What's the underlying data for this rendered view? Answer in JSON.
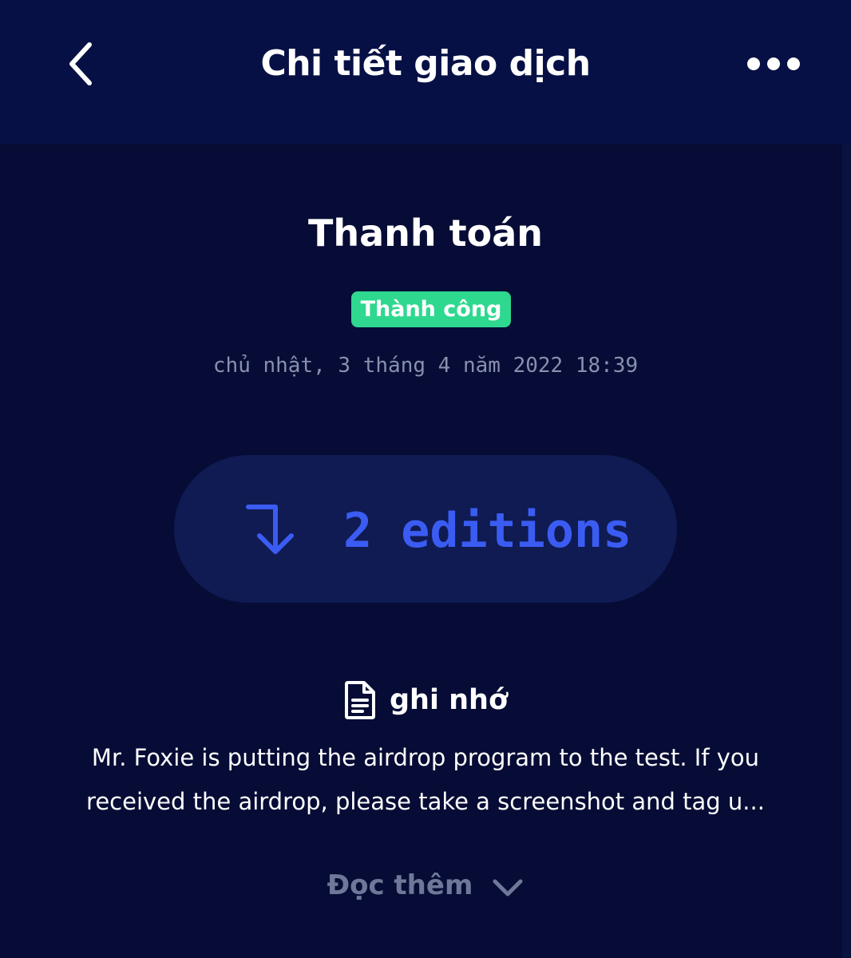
{
  "header": {
    "title": "Chi tiết giao dịch",
    "back_icon": "chevron-left-icon",
    "more_icon": "more-horizontal-icon"
  },
  "transaction": {
    "type": "Thanh toán",
    "status": "Thành công",
    "status_color": "#2fd88f",
    "date": "chủ nhật, 3 tháng 4 năm 2022 18:39",
    "amount": "2 editions",
    "amount_icon": "arrow-turn-down-icon",
    "accent_color": "#3b5cf3"
  },
  "note": {
    "icon": "document-icon",
    "label": "ghi nhớ",
    "lines": [
      "Mr. Foxie is putting the airdrop program to the test. If you",
      "received the airdrop, please take a screenshot and tag u..."
    ],
    "read_more": "Đọc thêm",
    "read_more_icon": "chevron-down-icon"
  },
  "colors": {
    "background": "#060c35",
    "header_bg": "#071045",
    "pill_bg": "#0f1b52"
  }
}
